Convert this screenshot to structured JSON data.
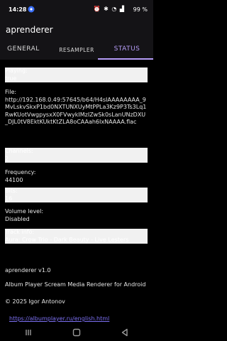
{
  "statusbar": {
    "time": "14:28",
    "battery": "99 %"
  },
  "app": {
    "title": "aprenderer"
  },
  "tabs": [
    {
      "label": "GENERAL"
    },
    {
      "label": "RESAMPLER"
    },
    {
      "label": "STATUS"
    }
  ],
  "status": {
    "playing": {
      "label": "Playing:",
      "value": "true"
    },
    "file": {
      "label": "File:",
      "value": "http://192.168.0.49:57645/b64/H4sIAAAAAAAA_9MvLskvSkxP1bd0NXTUNXUyMtPPLa3Kz9P3Ts3Lq1RwKUotVwgpysxX0FVwykIMzIZwSk0sLanUNzDXU_DJL0tV8EktKUktKtZLA8oCAAah6IxNAAAA.flac"
    },
    "channels": {
      "label": "Channels:",
      "value": "2"
    },
    "frequency": {
      "label": "Frequency:",
      "value": "44100"
    },
    "bits": {
      "label": "Bits:",
      "value": "16"
    },
    "volume": {
      "label": "Volume level:",
      "value": "Disabled"
    },
    "track": {
      "label": "Track info:",
      "value": "Aura: Crow Trio - Dark Beauty - Live Lesters"
    }
  },
  "about": {
    "version": "aprenderer v1.0",
    "description": "Album Player Scream Media Renderer for Android",
    "copyright": "© 2025 Igor Antonov",
    "link": "https://albumplayer.ru/english.html"
  },
  "colors": {
    "accent": "#b69df8",
    "link": "#7b6ff0",
    "background": "#000000"
  }
}
